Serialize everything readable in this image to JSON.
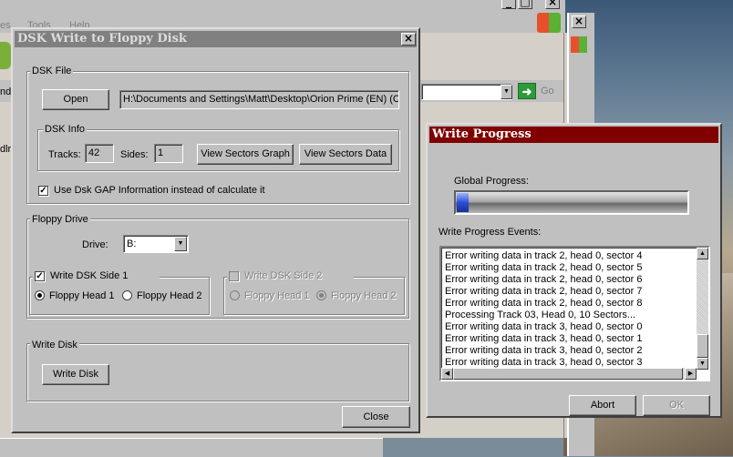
{
  "background_window": {
    "menu": {
      "tools": "Tools",
      "help": "Help"
    },
    "edge_text_1": "es",
    "edge_text_2": "nd",
    "edge_text_3": "dlr",
    "go_label": "Go"
  },
  "dsk_dialog": {
    "title": "DSK Write to Floppy Disk",
    "dsk_file": {
      "group_label": "DSK File",
      "open_label": "Open",
      "path_value": "H:\\Documents and Settings\\Matt\\Desktop\\Orion Prime (EN) (C"
    },
    "dsk_info": {
      "group_label": "DSK Info",
      "tracks_label": "Tracks:",
      "tracks_value": "42",
      "sides_label": "Sides:",
      "sides_value": "1",
      "view_graph_label": "View Sectors Graph",
      "view_data_label": "View Sectors Data",
      "gap_checkbox_label": "Use Dsk GAP Information instead of calculate it",
      "gap_checked": true
    },
    "floppy_drive": {
      "group_label": "Floppy Drive",
      "drive_label": "Drive:",
      "drive_value": "B:",
      "side1": {
        "label": "Write DSK Side 1",
        "checked": true,
        "head1": "Floppy Head 1",
        "head2": "Floppy Head 2",
        "selected": "head1"
      },
      "side2": {
        "label": "Write DSK Side 2",
        "checked": false,
        "head1": "Floppy Head 1",
        "head2": "Floppy Head 2",
        "selected": "head2"
      }
    },
    "write_disk": {
      "group_label": "Write Disk",
      "button_label": "Write Disk"
    },
    "close_label": "Close"
  },
  "progress_dialog": {
    "title": "Write Progress",
    "global_label": "Global Progress:",
    "progress_fraction": 0.05,
    "events_label": "Write Progress Events:",
    "events": [
      "Error writing data in track 2, head 0, sector 4",
      "Error writing data in track 2, head 0, sector 5",
      "Error writing data in track 2, head 0, sector 6",
      "Error writing data in track 2, head 0, sector 7",
      "Error writing data in track 2, head 0, sector 8",
      "Processing Track 03, Head 0, 10 Sectors...",
      "Error writing data in track 3, head 0, sector 0",
      "Error writing data in track 3, head 0, sector 1",
      "Error writing data in track 3, head 0, sector 2",
      "Error writing data in track 3, head 0, sector 3"
    ],
    "abort_label": "Abort",
    "ok_label": "OK"
  },
  "colors": {
    "dialog_face": "#c0c0c0",
    "dsk_title_bg": "#808080",
    "progress_title_bg": "#800000",
    "progress_fill": "#2a4fd8"
  }
}
